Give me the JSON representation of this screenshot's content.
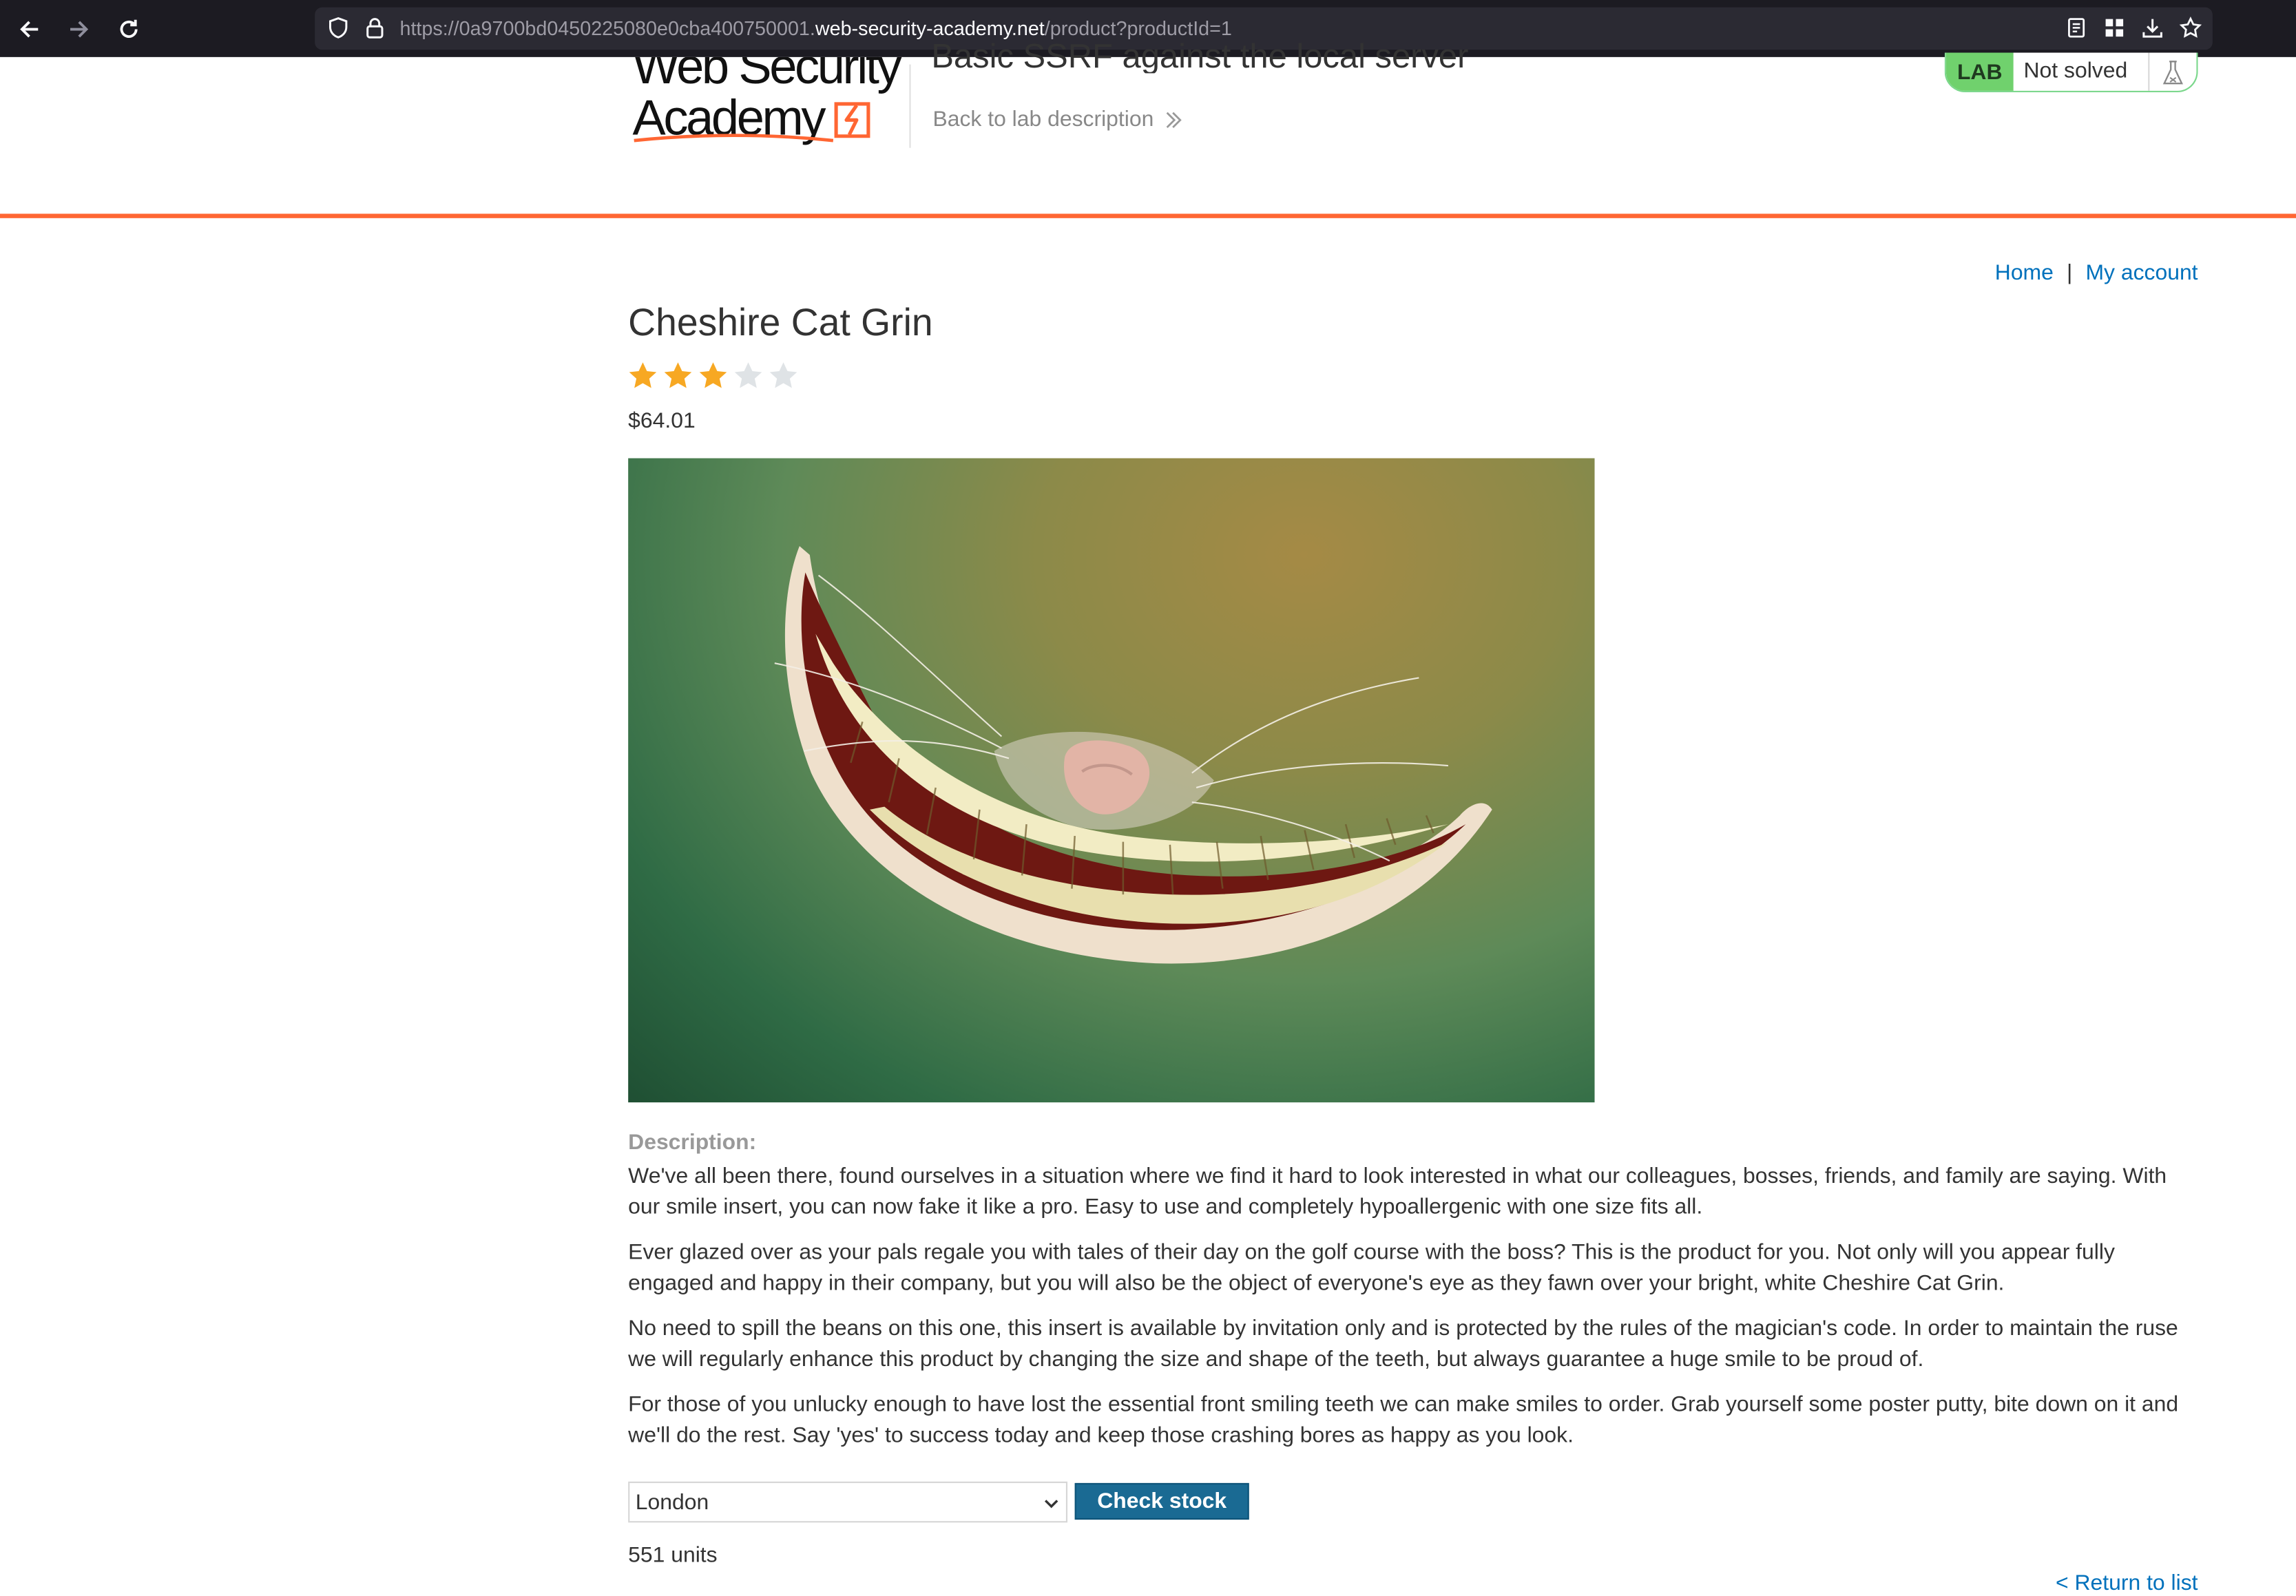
{
  "browser": {
    "url_prefix": "https://0a9700bd0450225080e0cba400750001.",
    "url_host": "web-security-academy.net",
    "url_path": "/product?productId=1",
    "icons": [
      "back-arrow-icon",
      "forward-arrow-icon",
      "reload-icon",
      "shield-icon",
      "lock-icon",
      "reader-view-icon",
      "extensions-icon",
      "downloads-icon",
      "bookmark-star-icon"
    ]
  },
  "header": {
    "logo_line1": "Web Security",
    "logo_line2": "Academy",
    "lab_title": "Basic SSRF against the local server",
    "back_link": "Back to lab description",
    "lab_badge": "LAB",
    "lab_status": "Not solved",
    "accent_color": "#ff6633",
    "badge_color": "#70d16d"
  },
  "account_nav": {
    "home": "Home",
    "separator": "|",
    "my_account": "My account"
  },
  "product": {
    "title": "Cheshire Cat Grin",
    "rating": 3,
    "rating_max": 5,
    "price": "$64.01",
    "image_subject": "cheshire-cat-grin-image",
    "description_label": "Description:",
    "description": [
      "We've all been there, found ourselves in a situation where we find it hard to look interested in what our colleagues, bosses, friends, and family are saying. With our smile insert, you can now fake it like a pro. Easy to use and completely hypoallergenic with one size fits all.",
      "Ever glazed over as your pals regale you with tales of their day on the golf course with the boss? This is the product for you. Not only will you appear fully engaged and happy in their company, but you will also be the object of everyone's eye as they fawn over your bright, white Cheshire Cat Grin.",
      "No need to spill the beans on this one, this insert is available by invitation only and is protected by the rules of the magician's code. In order to maintain the ruse we will regularly enhance this product by changing the size and shape of the teeth, but always guarantee a huge smile to be proud of.",
      "For those of you unlucky enough to have lost the essential front smiling teeth we can make smiles to order. Grab yourself some poster putty, bite down on it and we'll do the rest. Say 'yes' to success today and keep those crashing bores as happy as you look."
    ]
  },
  "stock": {
    "selected_store": "London",
    "check_button": "Check stock",
    "result": "551 units",
    "return_link": "< Return to list"
  }
}
